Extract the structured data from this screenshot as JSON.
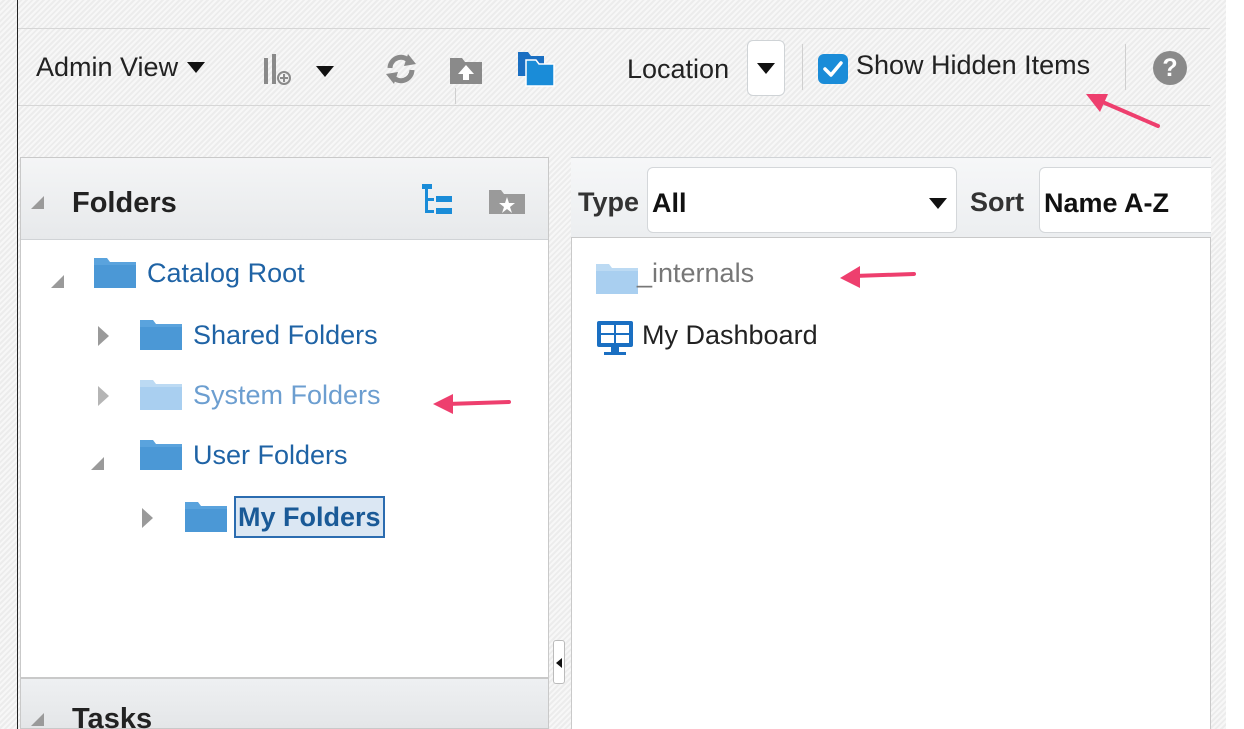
{
  "toolbar": {
    "view_label": "Admin View",
    "location_label": "Location",
    "show_hidden_label": "Show Hidden Items",
    "show_hidden_checked": true,
    "help_glyph": "?"
  },
  "folders_panel": {
    "title": "Folders",
    "tree": {
      "root": "Catalog Root",
      "shared": "Shared Folders",
      "system": "System Folders",
      "user": "User Folders",
      "my": "My Folders"
    }
  },
  "tasks_panel": {
    "title": "Tasks"
  },
  "content_panel": {
    "type_label": "Type",
    "type_value": "All",
    "sort_label": "Sort",
    "sort_value": "Name A-Z",
    "items": {
      "internals": "_internals",
      "dashboard": "My Dashboard"
    }
  },
  "colors": {
    "accent": "#1a8cd8",
    "folder_blue": "#5aa3dd",
    "folder_faded": "#a9cff0",
    "link_blue": "#1f63a5",
    "annotation_arrow": "#ee3f6e"
  }
}
